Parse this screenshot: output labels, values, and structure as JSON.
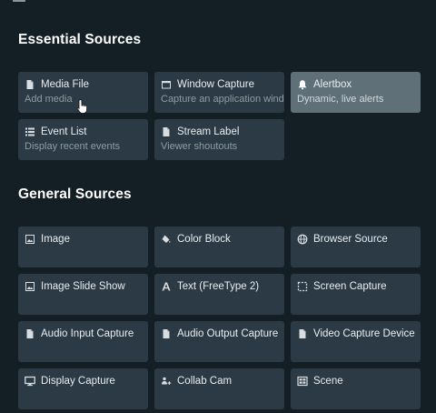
{
  "essential": {
    "title": "Essential Sources",
    "items": [
      {
        "name": "Media File",
        "desc": "Add media",
        "icon": "file-icon"
      },
      {
        "name": "Window Capture",
        "desc": "Capture an application window",
        "icon": "window-icon"
      },
      {
        "name": "Alertbox",
        "desc": "Dynamic, live alerts",
        "icon": "bell-icon"
      },
      {
        "name": "Event List",
        "desc": "Display recent events",
        "icon": "list-icon"
      },
      {
        "name": "Stream Label",
        "desc": "Viewer shoutouts",
        "icon": "file-icon"
      }
    ]
  },
  "general": {
    "title": "General Sources",
    "items": [
      {
        "name": "Image",
        "icon": "image-icon"
      },
      {
        "name": "Color Block",
        "icon": "paint-bucket-icon"
      },
      {
        "name": "Browser Source",
        "icon": "globe-icon"
      },
      {
        "name": "Image Slide Show",
        "icon": "image-icon"
      },
      {
        "name": "Text (FreeType 2)",
        "icon": "text-icon"
      },
      {
        "name": "Screen Capture",
        "icon": "dashed-square-icon"
      },
      {
        "name": "Audio Input Capture",
        "icon": "file-icon"
      },
      {
        "name": "Audio Output Capture",
        "icon": "file-icon"
      },
      {
        "name": "Video Capture Device",
        "icon": "file-icon"
      },
      {
        "name": "Display Capture",
        "icon": "monitor-icon"
      },
      {
        "name": "Collab Cam",
        "icon": "collab-icon"
      },
      {
        "name": "Scene",
        "icon": "scene-icon"
      }
    ]
  },
  "colors": {
    "background": "#141e25",
    "tile": "#2b3a44",
    "tile_active": "#5f7078",
    "muted_text": "#8f9ca4"
  }
}
